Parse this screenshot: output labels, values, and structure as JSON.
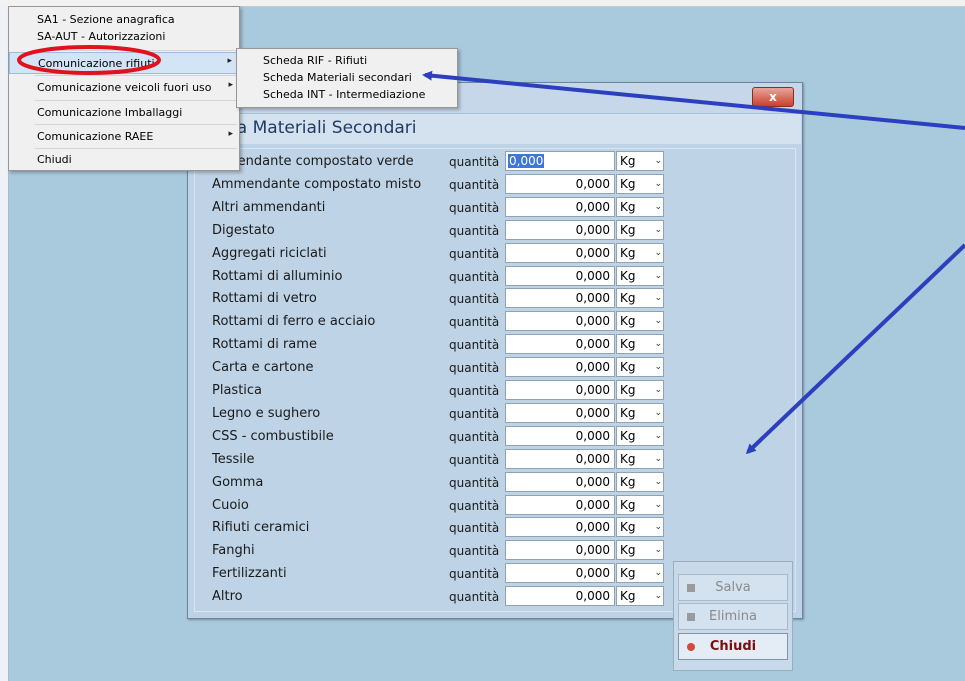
{
  "menu": {
    "items": [
      {
        "label": "SA1 - Sezione anagrafica",
        "submenu": false
      },
      {
        "label": "SA-AUT - Autorizzazioni",
        "submenu": false
      },
      {
        "label": "Comunicazione rifiuti",
        "submenu": true
      },
      {
        "label": "Comunicazione veicoli fuori uso",
        "submenu": true
      },
      {
        "label": "Comunicazione Imballaggi",
        "submenu": false
      },
      {
        "label": "Comunicazione RAEE",
        "submenu": true
      },
      {
        "label": "Chiudi",
        "submenu": false
      }
    ],
    "submenu_arrow": "▸"
  },
  "submenu": {
    "items": [
      {
        "label": "Scheda RIF - Rifiuti"
      },
      {
        "label": "Scheda Materiali secondari"
      },
      {
        "label": "Scheda INT - Intermediazione"
      }
    ]
  },
  "dialog": {
    "title_visible": "da Materiali Secondari",
    "close_glyph": "x",
    "quantity_label": "quantità",
    "unit_arrow": "⌄",
    "rows": [
      {
        "label": "mendante compostato verde",
        "value": "0,000",
        "unit": "Kg"
      },
      {
        "label": "Ammendante compostato misto",
        "value": "0,000",
        "unit": "Kg"
      },
      {
        "label": "Altri ammendanti",
        "value": "0,000",
        "unit": "Kg"
      },
      {
        "label": "Digestato",
        "value": "0,000",
        "unit": "Kg"
      },
      {
        "label": "Aggregati riciclati",
        "value": "0,000",
        "unit": "Kg"
      },
      {
        "label": "Rottami di alluminio",
        "value": "0,000",
        "unit": "Kg"
      },
      {
        "label": "Rottami di vetro",
        "value": "0,000",
        "unit": "Kg"
      },
      {
        "label": "Rottami di ferro e acciaio",
        "value": "0,000",
        "unit": "Kg"
      },
      {
        "label": "Rottami di rame",
        "value": "0,000",
        "unit": "Kg"
      },
      {
        "label": "Carta e cartone",
        "value": "0,000",
        "unit": "Kg"
      },
      {
        "label": "Plastica",
        "value": "0,000",
        "unit": "Kg"
      },
      {
        "label": "Legno e sughero",
        "value": "0,000",
        "unit": "Kg"
      },
      {
        "label": "CSS - combustibile",
        "value": "0,000",
        "unit": "Kg"
      },
      {
        "label": "Tessile",
        "value": "0,000",
        "unit": "Kg"
      },
      {
        "label": "Gomma",
        "value": "0,000",
        "unit": "Kg"
      },
      {
        "label": "Cuoio",
        "value": "0,000",
        "unit": "Kg"
      },
      {
        "label": "Rifiuti ceramici",
        "value": "0,000",
        "unit": "Kg"
      },
      {
        "label": "Fanghi",
        "value": "0,000",
        "unit": "Kg"
      },
      {
        "label": "Fertilizzanti",
        "value": "0,000",
        "unit": "Kg"
      },
      {
        "label": "Altro",
        "value": "0,000",
        "unit": "Kg"
      }
    ],
    "buttons": {
      "save": "Salva",
      "delete": "Elimina",
      "close": "Chiudi"
    }
  },
  "colors": {
    "desktop": "#a9c9dd",
    "annotation_arrow": "#2b3fbf",
    "annotation_circle": "#e0121b",
    "close_button_text": "#7a0e0e"
  }
}
